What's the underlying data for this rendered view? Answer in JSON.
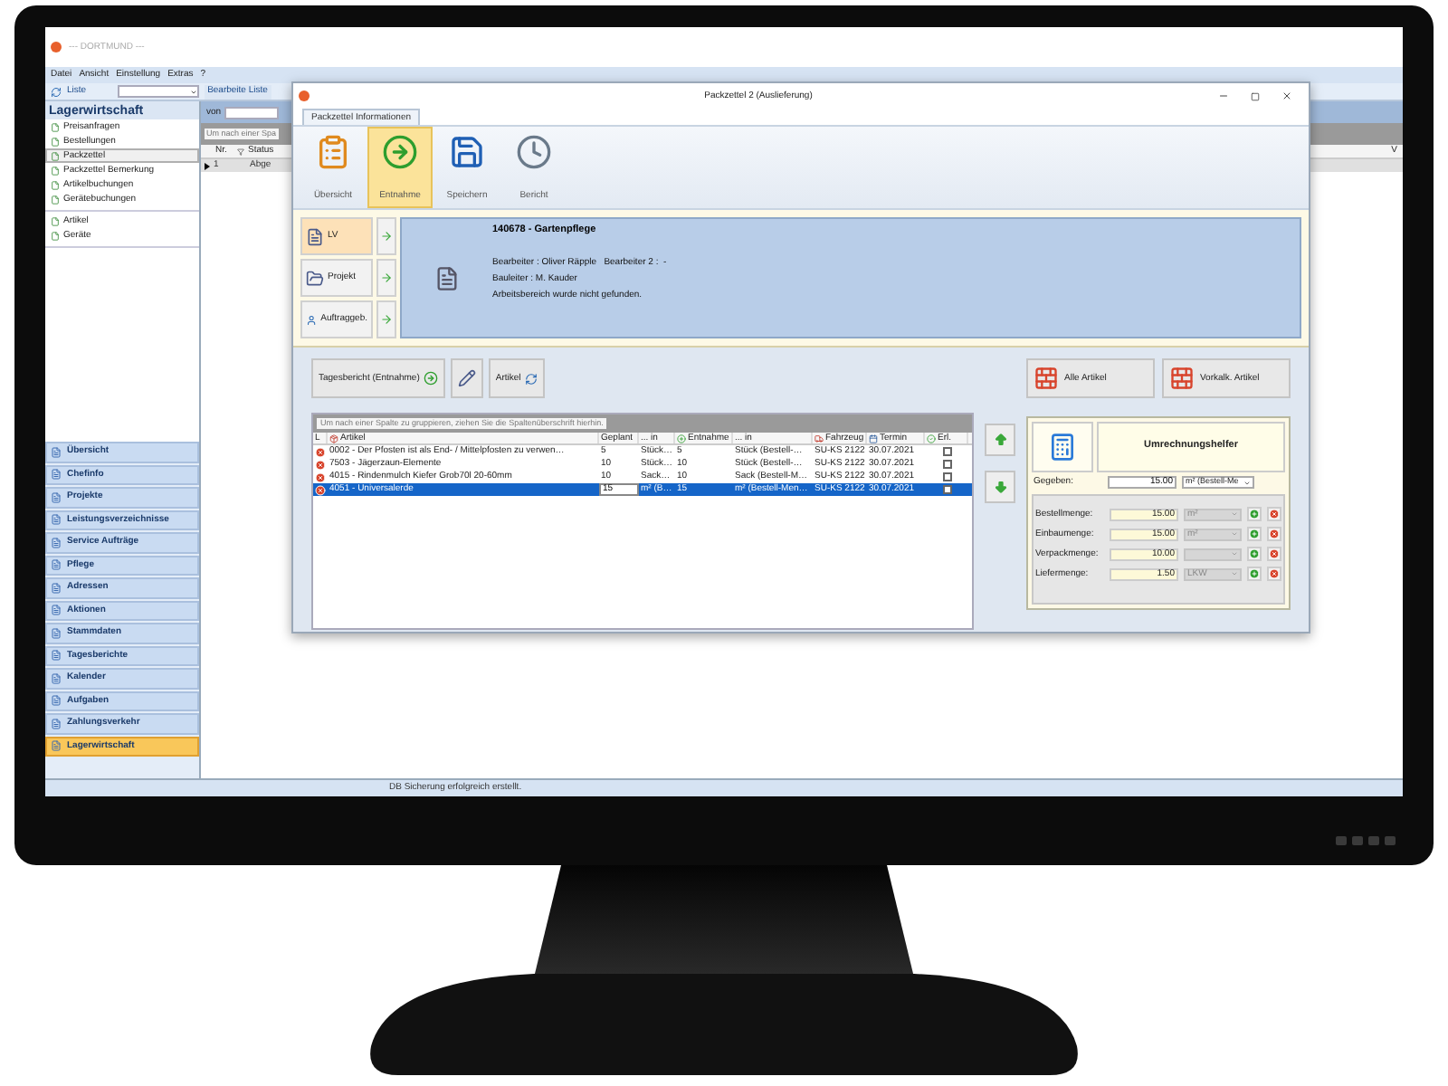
{
  "app": {
    "title": "--- DORTMUND ---",
    "menu": [
      "Datei",
      "Ansicht",
      "Einstellung",
      "Extras",
      "?"
    ],
    "toolbar": {
      "list_label": "Liste",
      "edit_list_button": "Bearbeite Liste"
    },
    "sidebar": {
      "title": "Lagerwirtschaft",
      "groups": [
        {
          "items": [
            {
              "label": "Preisanfragen",
              "selected": false
            },
            {
              "label": "Bestellungen",
              "selected": false
            },
            {
              "label": "Packzettel",
              "selected": true
            },
            {
              "label": "Packzettel Bemerkung",
              "selected": false
            },
            {
              "label": "Artikelbuchungen",
              "selected": false
            },
            {
              "label": "Gerätebuchungen",
              "selected": false
            }
          ]
        },
        {
          "items": [
            {
              "label": "Artikel",
              "selected": false
            },
            {
              "label": "Geräte",
              "selected": false
            }
          ]
        }
      ]
    },
    "nav": [
      {
        "label": "Übersicht",
        "selected": false
      },
      {
        "label": "Chefinfo",
        "selected": false
      },
      {
        "label": "Projekte",
        "selected": false
      },
      {
        "label": "Leistungsverzeichnisse",
        "selected": false
      },
      {
        "label": "Service Aufträge",
        "selected": false
      },
      {
        "label": "Pflege",
        "selected": false
      },
      {
        "label": "Adressen",
        "selected": false
      },
      {
        "label": "Aktionen",
        "selected": false
      },
      {
        "label": "Stammdaten",
        "selected": false
      },
      {
        "label": "Tagesberichte",
        "selected": false
      },
      {
        "label": "Kalender",
        "selected": false
      },
      {
        "label": "Aufgaben",
        "selected": false
      },
      {
        "label": "Zahlungsverkehr",
        "selected": false
      },
      {
        "label": "Lagerwirtschaft",
        "selected": true
      }
    ],
    "list": {
      "filter_label": "von",
      "group_hint": "Um nach einer Spa",
      "columns": [
        "Nr.",
        "Status"
      ],
      "column_3": "V",
      "rows": [
        {
          "cells": [
            "1",
            "Abge"
          ],
          "current": true
        }
      ]
    },
    "status_bar": "DB Sicherung erfolgreich erstellt."
  },
  "dialog": {
    "title": "Packzettel 2 (Auslieferung)",
    "tabs": [
      {
        "label": "Packzettel Informationen",
        "selected": true
      }
    ],
    "ribbon": [
      {
        "label": "Übersicht",
        "kind": "overview",
        "selected": false
      },
      {
        "label": "Entnahme",
        "kind": "take",
        "selected": true
      },
      {
        "label": "Speichern",
        "kind": "save",
        "selected": false
      },
      {
        "label": "Bericht",
        "kind": "report",
        "selected": false
      }
    ],
    "links": [
      {
        "label": "LV",
        "kind": "lv",
        "selected": true
      },
      {
        "label": "Projekt",
        "kind": "project",
        "selected": false
      },
      {
        "label": "Auftraggeb.",
        "kind": "client",
        "selected": false
      }
    ],
    "info": {
      "heading": "140678 - Gartenpflege",
      "lines": [
        "Bearbeiter : Oliver Räpple   Bearbeiter 2 :  -",
        "Bauleiter : M. Kauder",
        "Arbeitsbereich wurde nicht gefunden."
      ]
    },
    "actions": [
      {
        "label": "Tagesbericht (Entnahme)",
        "kind": "report"
      },
      {
        "kind": "edit"
      },
      {
        "label": "Artikel",
        "kind": "article"
      }
    ],
    "article_buttons": [
      "Alle Artikel",
      "Vorkalk. Artikel"
    ],
    "table": {
      "group_hint": "Um nach einer Spalte zu gruppieren, ziehen Sie die Spaltenüberschrift hierhin.",
      "columns": [
        {
          "label": "L",
          "kind": "plain"
        },
        {
          "label": "Artikel",
          "kind": "article"
        },
        {
          "label": "Geplant",
          "kind": "plain"
        },
        {
          "label": "... in",
          "kind": "plain"
        },
        {
          "label": "Entnahme",
          "kind": "take"
        },
        {
          "label": "... in",
          "kind": "plain"
        },
        {
          "label": "Fahrzeug",
          "kind": "truck"
        },
        {
          "label": "Termin",
          "kind": "calendar"
        },
        {
          "label": "Erl.",
          "kind": "done"
        }
      ],
      "rows": [
        {
          "cells": [
            "",
            "0002 - Der Pfosten ist als End- / Mittelpfosten zu verwen…",
            "5",
            "Stück…",
            "5",
            "Stück (Bestell-…",
            "SU-KS 2122",
            "30.07.2021"
          ],
          "done": false,
          "selected": false
        },
        {
          "cells": [
            "",
            "7503 - Jägerzaun-Elemente",
            "10",
            "Stück…",
            "10",
            "Stück (Bestell-…",
            "SU-KS 2122",
            "30.07.2021"
          ],
          "done": false,
          "selected": false
        },
        {
          "cells": [
            "",
            "4015 - Rindenmulch Kiefer Grob70l 20-60mm",
            "10",
            "Sack…",
            "10",
            "Sack (Bestell-M…",
            "SU-KS 2122",
            "30.07.2021"
          ],
          "done": false,
          "selected": false
        },
        {
          "cells": [
            "",
            "4051 - Universalerde",
            "15",
            "m² (B…",
            "15",
            "m² (Bestell-Men…",
            "SU-KS 2122",
            "30.07.2021"
          ],
          "done": false,
          "selected": true
        }
      ]
    },
    "converter": {
      "title": "Umrechnungshelfer",
      "given": {
        "label": "Gegeben:",
        "value": "15.00",
        "unit": "m² (Bestell-Me"
      },
      "rows": [
        {
          "label": "Bestellmenge:",
          "value": "15.00",
          "unit": "m²"
        },
        {
          "label": "Einbaumenge:",
          "value": "15.00",
          "unit": "m²"
        },
        {
          "label": "Verpackmenge:",
          "value": "10.00"
        },
        {
          "label": "Liefermenge:",
          "value": "1.50",
          "unit": "LKW"
        }
      ]
    }
  }
}
